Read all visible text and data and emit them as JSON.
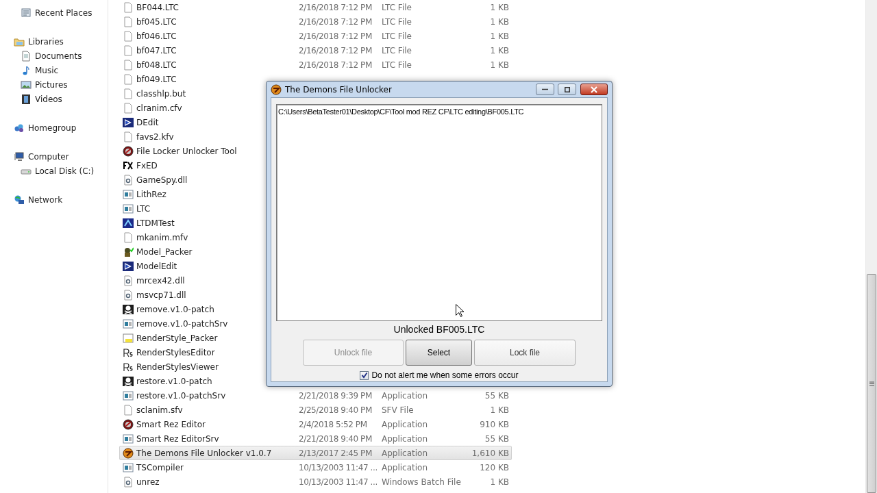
{
  "sidebar": {
    "sections": [
      {
        "children": [
          {
            "label": "Recent Places",
            "kind": "places"
          }
        ]
      },
      {
        "label": "Libraries",
        "kind": "library",
        "children": [
          {
            "label": "Documents",
            "kind": "doc"
          },
          {
            "label": "Music",
            "kind": "music"
          },
          {
            "label": "Pictures",
            "kind": "pics"
          },
          {
            "label": "Videos",
            "kind": "video"
          }
        ]
      },
      {
        "label": "Homegroup",
        "kind": "home"
      },
      {
        "label": "Computer",
        "kind": "computer",
        "children": [
          {
            "label": "Local Disk (C:)",
            "kind": "disk"
          }
        ]
      },
      {
        "label": "Network",
        "kind": "network"
      }
    ]
  },
  "files": [
    {
      "name": "BF044.LTC",
      "kind": "blank",
      "date": "2/16/2018 7:12 PM",
      "type": "LTC File",
      "size": "1 KB",
      "selected": false
    },
    {
      "name": "bf045.LTC",
      "kind": "blank",
      "date": "2/16/2018 7:12 PM",
      "type": "LTC File",
      "size": "1 KB",
      "selected": false
    },
    {
      "name": "bf046.LTC",
      "kind": "blank",
      "date": "2/16/2018 7:12 PM",
      "type": "LTC File",
      "size": "1 KB",
      "selected": false
    },
    {
      "name": "bf047.LTC",
      "kind": "blank",
      "date": "2/16/2018 7:12 PM",
      "type": "LTC File",
      "size": "1 KB",
      "selected": false
    },
    {
      "name": "bf048.LTC",
      "kind": "blank",
      "date": "2/16/2018 7:12 PM",
      "type": "LTC File",
      "size": "1 KB",
      "selected": false
    },
    {
      "name": "bf049.LTC",
      "kind": "blank",
      "selected": false
    },
    {
      "name": "classhlp.but",
      "kind": "blank",
      "selected": false
    },
    {
      "name": "clranim.cfv",
      "kind": "blank",
      "selected": false
    },
    {
      "name": "DEdit",
      "kind": "dedit",
      "selected": false
    },
    {
      "name": "favs2.kfv",
      "kind": "blank",
      "selected": false
    },
    {
      "name": "File Locker Unlocker Tool",
      "kind": "ring",
      "selected": false
    },
    {
      "name": "FxED",
      "kind": "fx",
      "selected": false
    },
    {
      "name": "GameSpy.dll",
      "kind": "dll",
      "selected": false
    },
    {
      "name": "LithRez",
      "kind": "app",
      "selected": false
    },
    {
      "name": "LTC",
      "kind": "app",
      "selected": false
    },
    {
      "name": "LTDMTest",
      "kind": "ltdm",
      "selected": false
    },
    {
      "name": "mkanim.mfv",
      "kind": "blank",
      "selected": false
    },
    {
      "name": "Model_Packer",
      "kind": "model",
      "selected": false
    },
    {
      "name": "ModelEdit",
      "kind": "dedit",
      "selected": false
    },
    {
      "name": "mrcex42.dll",
      "kind": "dll",
      "selected": false
    },
    {
      "name": "msvcp71.dll",
      "kind": "dll",
      "selected": false
    },
    {
      "name": "remove.v1.0-patch",
      "kind": "pirate",
      "selected": false
    },
    {
      "name": "remove.v1.0-patchSrv",
      "kind": "app",
      "selected": false
    },
    {
      "name": "RenderStyle_Packer",
      "kind": "packer",
      "selected": false
    },
    {
      "name": "RenderStylesEditor",
      "kind": "rs",
      "selected": false
    },
    {
      "name": "RenderStylesViewer",
      "kind": "rs",
      "selected": false
    },
    {
      "name": "restore.v1.0-patch",
      "kind": "pirate",
      "selected": false
    },
    {
      "name": "restore.v1.0-patchSrv",
      "kind": "app",
      "date": "2/21/2018 9:39 PM",
      "type": "Application",
      "size": "55 KB",
      "selected": false
    },
    {
      "name": "sclanim.sfv",
      "kind": "blank",
      "date": "2/25/2018 9:40 PM",
      "type": "SFV File",
      "size": "1 KB",
      "selected": false
    },
    {
      "name": "Smart Rez Editor",
      "kind": "ring",
      "date": "2/4/2018 5:52 PM",
      "type": "Application",
      "size": "910 KB",
      "selected": false
    },
    {
      "name": "Smart Rez EditorSrv",
      "kind": "app",
      "date": "2/21/2018 9:40 PM",
      "type": "Application",
      "size": "55 KB",
      "selected": false
    },
    {
      "name": "The Demons File Unlocker v1.0.7",
      "kind": "demon",
      "date": "2/13/2017 2:45 PM",
      "type": "Application",
      "size": "1,610 KB",
      "selected": true
    },
    {
      "name": "TSCompiler",
      "kind": "app",
      "date": "10/13/2003 11:47 ...",
      "type": "Application",
      "size": "120 KB",
      "selected": false
    },
    {
      "name": "unrez",
      "kind": "dll",
      "date": "10/13/2003 11:47 ...",
      "type": "Windows Batch File",
      "size": "1 KB",
      "selected": false
    }
  ],
  "dialog": {
    "title": "The Demons File Unlocker",
    "path": "C:\\Users\\BetaTester01\\Desktop\\CF\\Tool mod REZ CF\\LTC editing\\BF005.LTC",
    "status": "Unlocked BF005.LTC",
    "buttons": [
      {
        "label": "Unlock file",
        "disabled": true,
        "focused": false
      },
      {
        "label": "Select",
        "disabled": false,
        "focused": true
      },
      {
        "label": "Lock file",
        "disabled": false,
        "focused": false
      }
    ],
    "checkbox": {
      "label": "Do not alert me when some errors occur",
      "checked": true
    }
  }
}
